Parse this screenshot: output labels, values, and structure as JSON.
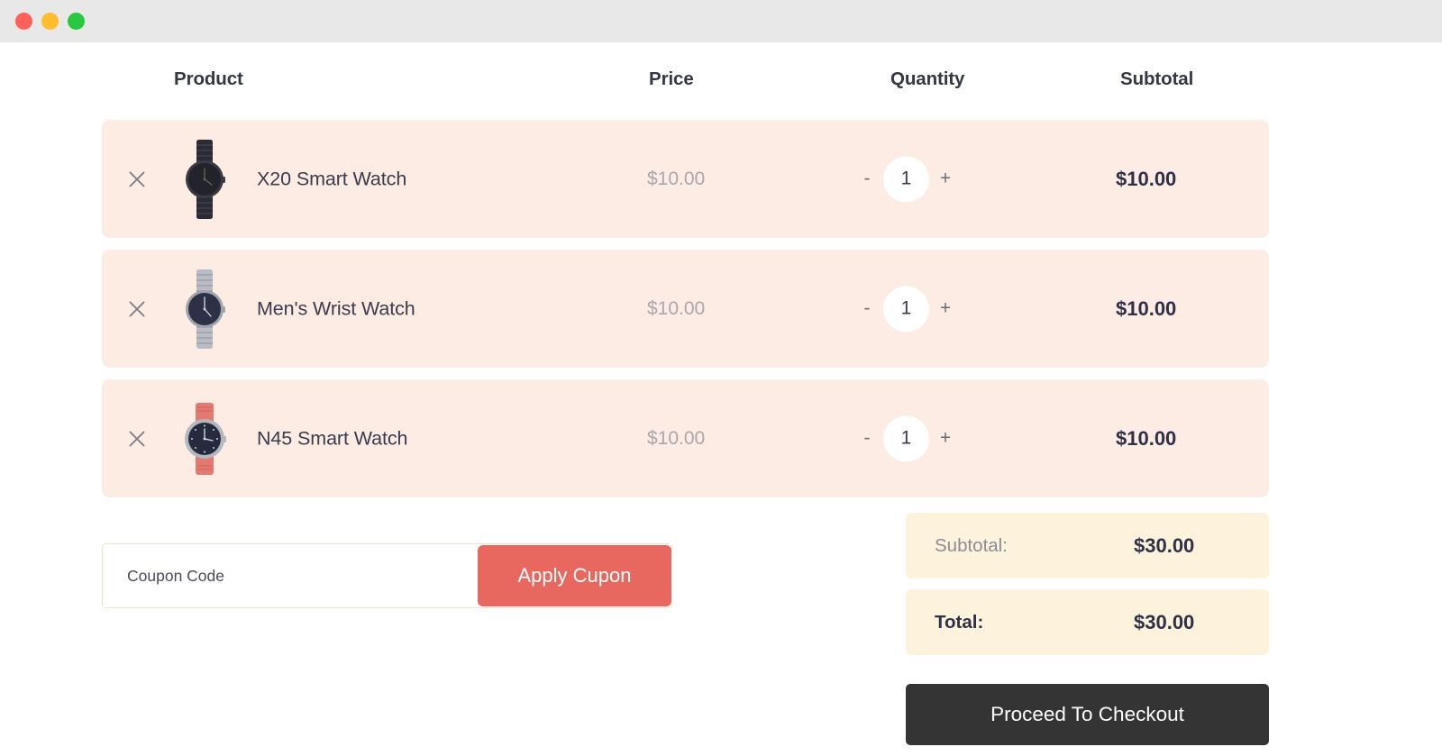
{
  "window": {
    "traffic_lights": [
      {
        "name": "close",
        "color": "#ff6159"
      },
      {
        "name": "minimize",
        "color": "#ffbd2e"
      },
      {
        "name": "maximize",
        "color": "#26c940"
      }
    ]
  },
  "cart": {
    "columns": {
      "product": "Product",
      "price": "Price",
      "quantity": "Quantity",
      "subtotal": "Subtotal"
    },
    "row_background": "#fcece4",
    "items": [
      {
        "remove_icon": "close-icon",
        "image_icon": "watch-black-bracelet-icon",
        "name": "X20 Smart Watch",
        "price": "$10.00",
        "decrement_label": "-",
        "quantity": "1",
        "increment_label": "+",
        "subtotal": "$10.00",
        "band_color": "#2b2b34",
        "dial_color": "#23232c",
        "bezel_color": "#3a3a45"
      },
      {
        "remove_icon": "close-icon",
        "image_icon": "watch-silver-bracelet-icon",
        "name": "Men's Wrist Watch",
        "price": "$10.00",
        "decrement_label": "-",
        "quantity": "1",
        "increment_label": "+",
        "subtotal": "$10.00",
        "band_color": "#b9bcc4",
        "dial_color": "#2c3146",
        "bezel_color": "#9ea3ad"
      },
      {
        "remove_icon": "close-icon",
        "image_icon": "watch-red-leather-icon",
        "name": "N45 Smart Watch",
        "price": "$10.00",
        "decrement_label": "-",
        "quantity": "1",
        "increment_label": "+",
        "subtotal": "$10.00",
        "band_color": "#e4796f",
        "dial_color": "#252a3d",
        "bezel_color": "#b3b7bf"
      }
    ]
  },
  "coupon": {
    "placeholder": "Coupon Code",
    "value": "",
    "apply_label": "Apply Cupon",
    "apply_color": "#e8675f"
  },
  "summary": {
    "rows": [
      {
        "label": "Subtotal:",
        "value": "$30.00",
        "emphasis": "muted"
      },
      {
        "label": "Total:",
        "value": "$30.00",
        "emphasis": "strong"
      }
    ],
    "background": "#fdf3dc"
  },
  "checkout": {
    "label": "Proceed To Checkout",
    "color": "#343434"
  }
}
